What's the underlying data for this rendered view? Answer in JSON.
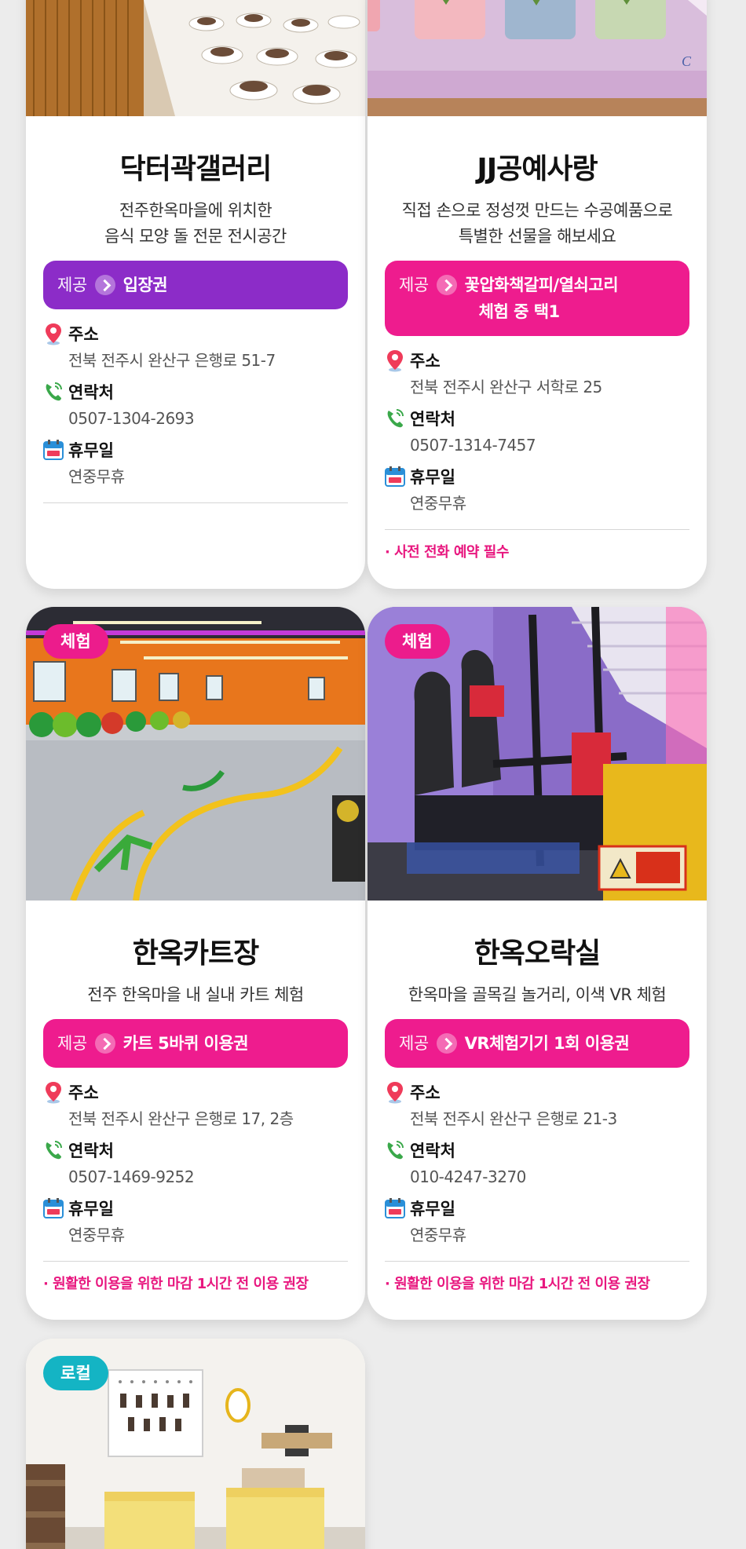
{
  "cards": [
    {
      "title": "닥터곽갤러리",
      "desc1": "전주한옥마을에 위치한",
      "desc2": "음식 모양 돌 전문 전시공간",
      "offer_label": "제공",
      "offer": "입장권",
      "offer_color": "#8c2cc8",
      "address_label": "주소",
      "address": "전북 전주시 완산구 은행로 51-7",
      "contact_label": "연락처",
      "contact": "0507-1304-2693",
      "holiday_label": "휴무일",
      "holiday": "연중무휴"
    },
    {
      "title": "JJ공예사랑",
      "desc1": "직접 손으로 정성껏 만드는 수공예품으로",
      "desc2": "특별한 선물을 해보세요",
      "offer_label": "제공",
      "offer_line1": "꽃압화책갈피/열쇠고리",
      "offer_line2": "체험 중 택1",
      "offer_color": "#ee1c8e",
      "address_label": "주소",
      "address": "전북 전주시 완산구 서학로 25",
      "contact_label": "연락처",
      "contact": "0507-1314-7457",
      "holiday_label": "휴무일",
      "holiday": "연중무휴",
      "note": "· 사전 전화 예약 필수"
    },
    {
      "tag": "체험",
      "title": "한옥카트장",
      "desc1": "전주 한옥마을 내 실내 카트 체험",
      "offer_label": "제공",
      "offer": "카트 5바퀴 이용권",
      "offer_color": "#ee1c8e",
      "address_label": "주소",
      "address": "전북 전주시 완산구 은행로 17, 2층",
      "contact_label": "연락처",
      "contact": "0507-1469-9252",
      "holiday_label": "휴무일",
      "holiday": "연중무휴",
      "note": "· 원활한 이용을 위한 마감 1시간 전 이용 권장"
    },
    {
      "tag": "체험",
      "title": "한옥오락실",
      "desc1": "한옥마을 골목길 놀거리, 이색 VR 체험",
      "offer_label": "제공",
      "offer": "VR체험기기 1회 이용권",
      "offer_color": "#ee1c8e",
      "address_label": "주소",
      "address": "전북 전주시 완산구 은행로 21-3",
      "contact_label": "연락처",
      "contact": "010-4247-3270",
      "holiday_label": "휴무일",
      "holiday": "연중무휴",
      "note": "· 원활한 이용을 위한 마감 1시간 전 이용 권장"
    },
    {
      "tag": "로컬"
    }
  ],
  "colors": {
    "accent_pink": "#ee1c8e",
    "accent_purple": "#8c2cc8",
    "tag_teal": "#14b4c4",
    "note_pink": "#e8177f"
  },
  "icons": [
    "map-pin-icon",
    "phone-icon",
    "calendar-icon",
    "chevron-right-icon"
  ]
}
